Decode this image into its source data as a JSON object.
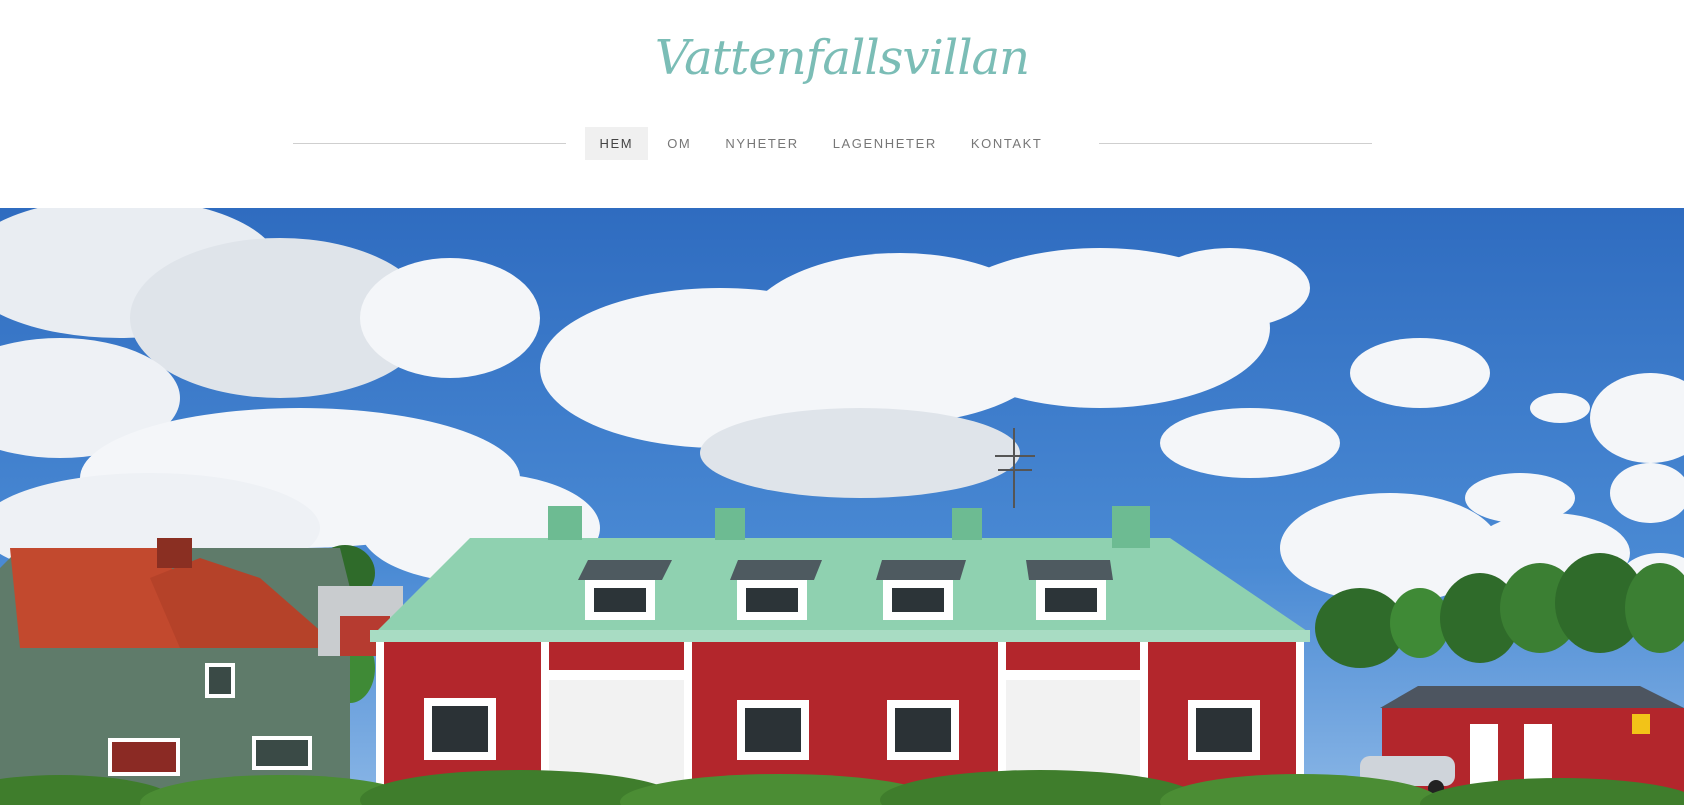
{
  "site": {
    "title": "Vattenfallsvillan"
  },
  "nav": {
    "items": [
      {
        "label": "HEM",
        "active": true
      },
      {
        "label": "OM",
        "active": false
      },
      {
        "label": "NYHETER",
        "active": false
      },
      {
        "label": "LAGENHETER",
        "active": false
      },
      {
        "label": "KONTAKT",
        "active": false
      }
    ]
  },
  "colors": {
    "logo": "#7bbdb6",
    "sky": "#3f7bc9",
    "house_wall": "#b3262c",
    "roof": "#8fd1b0"
  },
  "hero": {
    "image": "photo-of-red-wooden-house-with-green-roof-under-cloudy-sky"
  }
}
